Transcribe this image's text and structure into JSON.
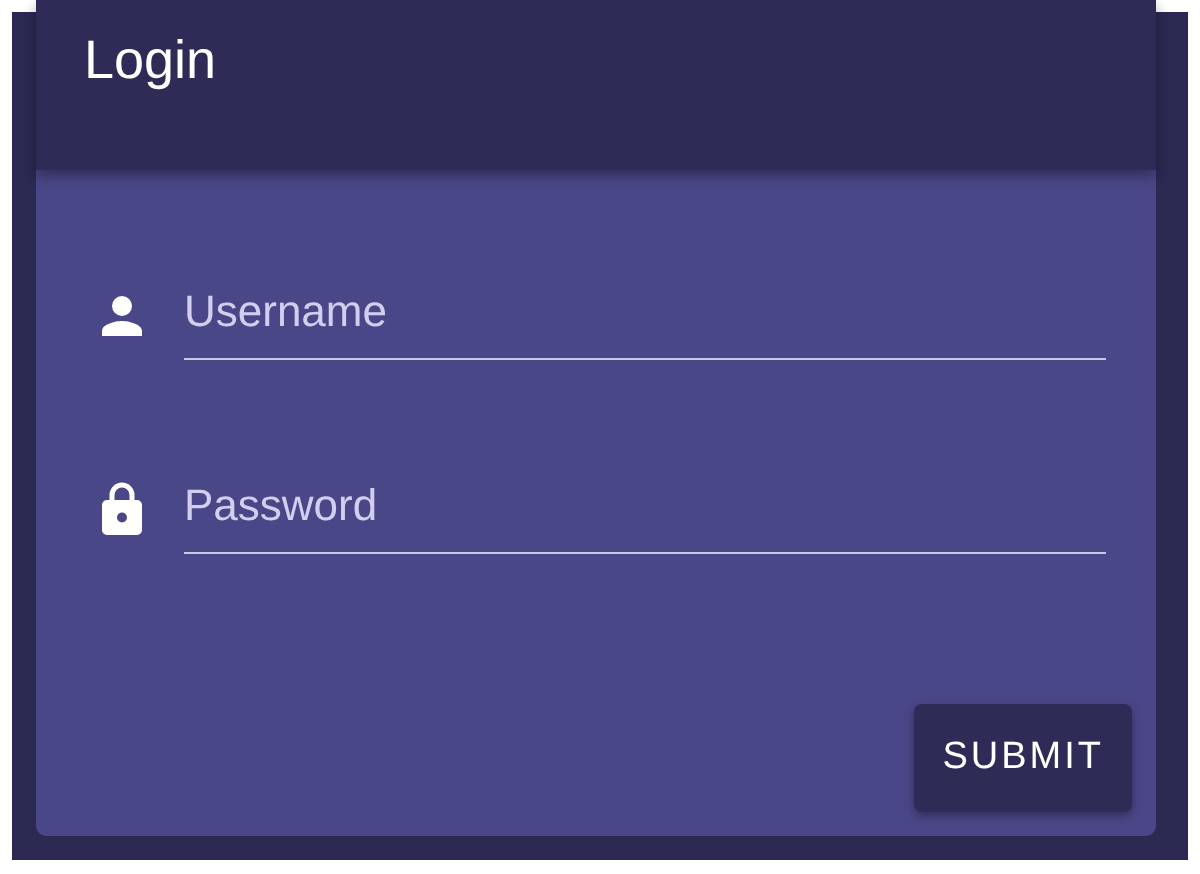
{
  "header": {
    "title": "Login"
  },
  "fields": [
    {
      "kind": "user",
      "placeholder": "Username"
    },
    {
      "kind": "lock",
      "placeholder": "Password"
    }
  ],
  "submit_button": {
    "label": "SUBMIT"
  }
}
